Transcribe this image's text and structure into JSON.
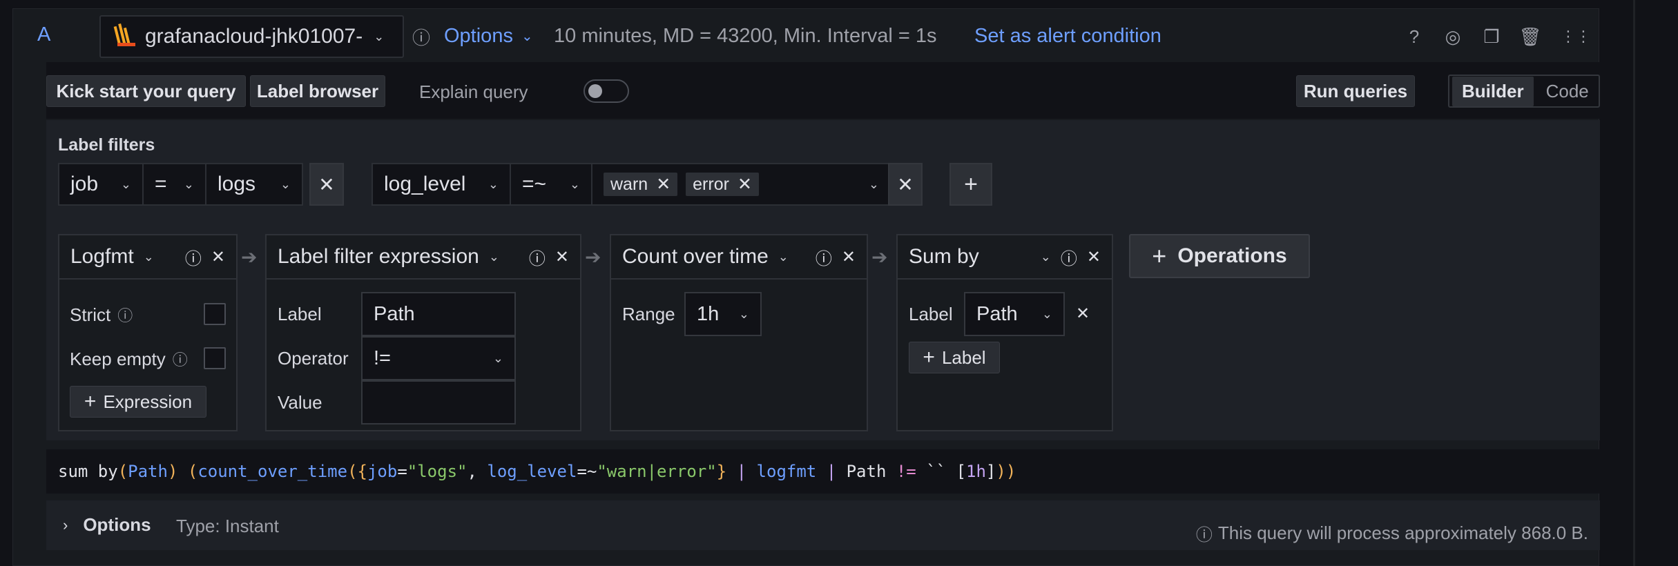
{
  "header": {
    "query_letter": "A",
    "datasource": "grafanacloud-jhk01007-",
    "options_label": "Options",
    "query_info": "10 minutes, MD = 43200, Min. Interval = 1s",
    "alert_link": "Set as alert condition",
    "icons": [
      "help-icon",
      "eye-icon",
      "duplicate-icon",
      "trash-icon",
      "drag-handle-icon"
    ]
  },
  "toolbar": {
    "kickstart": "Kick start your query",
    "label_browser": "Label browser",
    "explain": "Explain query",
    "explain_on": false,
    "run": "Run queries",
    "builder": "Builder",
    "code": "Code"
  },
  "label_filters": {
    "title": "Label filters",
    "filters": [
      {
        "label": "job",
        "op": "=",
        "value": "logs"
      },
      {
        "label": "log_level",
        "op": "=~",
        "values": [
          "warn",
          "error"
        ]
      }
    ]
  },
  "operations": {
    "logfmt": {
      "name": "Logfmt",
      "strict": "Strict",
      "keep_empty": "Keep empty",
      "add": "Expression"
    },
    "label_filter": {
      "name": "Label filter expression",
      "label_lbl": "Label",
      "label_val": "Path",
      "operator_lbl": "Operator",
      "operator_val": "!=",
      "value_lbl": "Value",
      "value_val": ""
    },
    "count": {
      "name": "Count over time",
      "range_lbl": "Range",
      "range_val": "1h"
    },
    "sum": {
      "name": "Sum by",
      "label_lbl": "Label",
      "label_val": "Path",
      "add": "Label"
    },
    "add_ops": "Operations"
  },
  "query_text": {
    "p1": "sum by",
    "p2": "(",
    "p3": "Path",
    "p4": ") ",
    "p5": "(",
    "p6": "count_over_time",
    "p7": "(",
    "p8": "{",
    "p9": "job",
    "p10": "=",
    "p11": "\"logs\"",
    "p12": ", ",
    "p13": "log_level",
    "p14": "=~",
    "p15": "\"warn|error\"",
    "p16": "}",
    "p17": " | ",
    "p18": "logfmt",
    "p19": " | ",
    "p20": "Path ",
    "p21": "!=",
    "p22": " `` ",
    "p23": "[",
    "p24": "1h",
    "p25": "]",
    "p26": "))"
  },
  "footer": {
    "options": "Options",
    "type": "Type: Instant",
    "estimate": "This query will process approximately 868.0 B."
  }
}
